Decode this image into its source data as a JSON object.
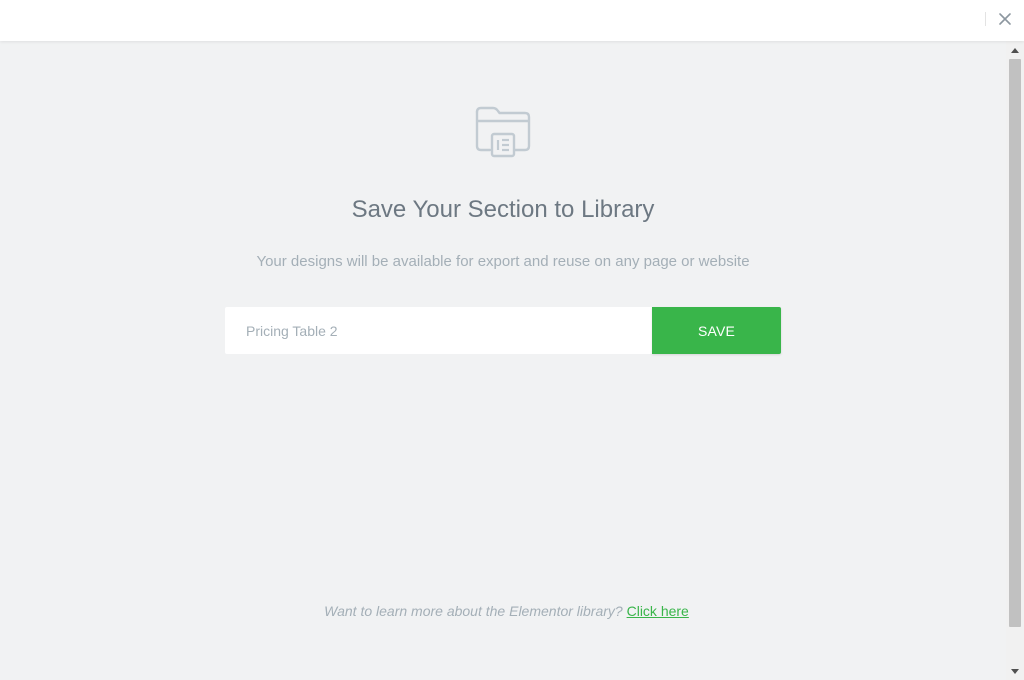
{
  "header": {
    "close_glyph": "✕",
    "close_icon": "close-icon"
  },
  "main": {
    "icon": "folder-library-icon",
    "title": "Save Your Section to Library",
    "subtitle": "Your designs will be available for export and reuse on any page or website",
    "form": {
      "input_value": "",
      "input_placeholder": "Pricing Table 2",
      "save_label": "SAVE"
    }
  },
  "footer": {
    "text": "Want to learn more about the Elementor library?",
    "link_text": "Click here"
  },
  "colors": {
    "accent": "#39b54a",
    "background": "#f1f2f3",
    "title": "#6d7882",
    "muted": "#a4afb7"
  }
}
